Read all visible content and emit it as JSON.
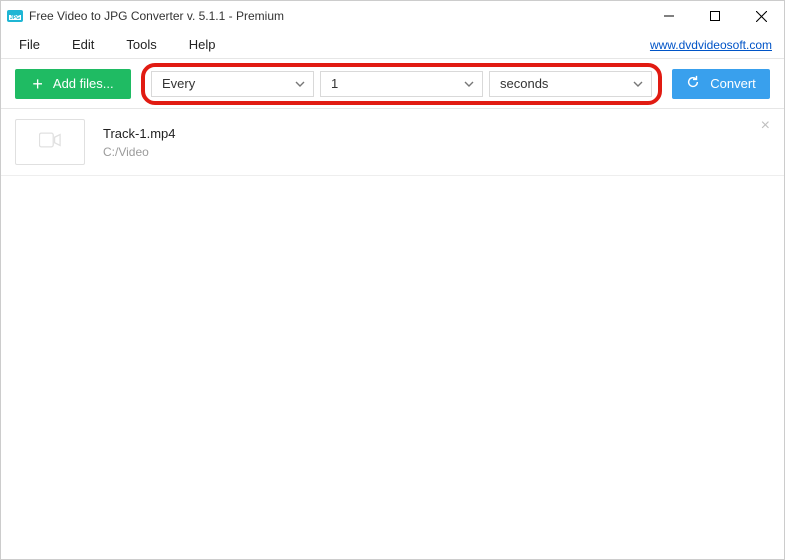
{
  "window": {
    "title": "Free Video to JPG Converter v. 5.1.1 - Premium"
  },
  "menu": {
    "file": "File",
    "edit": "Edit",
    "tools": "Tools",
    "help": "Help",
    "link": "www.dvdvideosoft.com"
  },
  "toolbar": {
    "add_label": "Add files...",
    "convert_label": "Convert",
    "mode": {
      "value": "Every"
    },
    "count": {
      "value": "1"
    },
    "unit": {
      "value": "seconds"
    }
  },
  "files": {
    "item0": {
      "name": "Track-1.mp4",
      "path": "C:/Video"
    }
  }
}
